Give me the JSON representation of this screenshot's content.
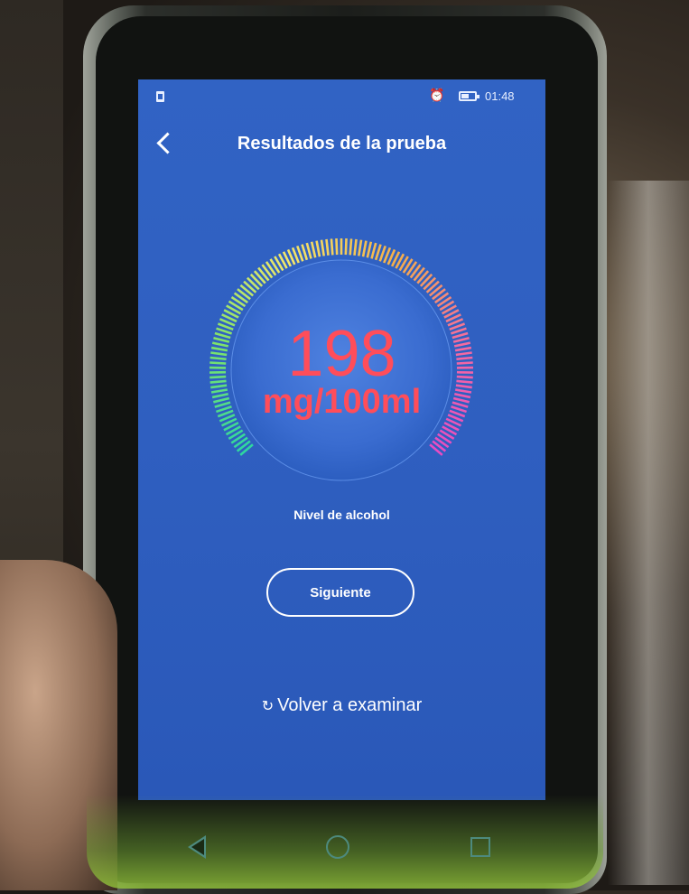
{
  "status_bar": {
    "time": "01:48"
  },
  "header": {
    "title": "Resultados de la prueba"
  },
  "reading": {
    "value": "198",
    "unit": "mg/100ml",
    "caption": "Nivel de alcohol"
  },
  "actions": {
    "next_label": "Siguiente",
    "retest_label": "Volver a examinar"
  },
  "colors": {
    "screen_bg": "#3163c4",
    "reading_text": "#ff4d5a",
    "gauge_gradient": [
      "#2fd7a0",
      "#7ee36a",
      "#f3e86a",
      "#f5b04a",
      "#f46aa0",
      "#e84cc2"
    ]
  },
  "icons": {
    "status": [
      "sim-icon",
      "alarm-icon",
      "battery-icon"
    ],
    "nav": [
      "back-triangle-icon",
      "home-circle-icon",
      "recents-square-icon"
    ],
    "header": "back-chevron-icon",
    "retest": "refresh-icon"
  }
}
